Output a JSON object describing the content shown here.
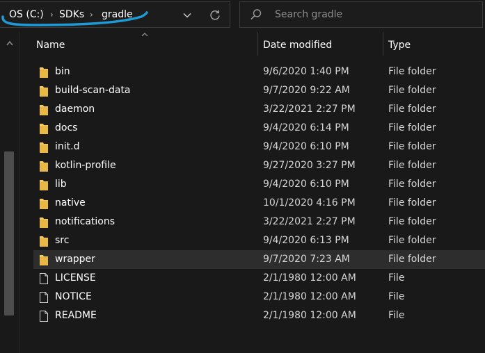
{
  "address_bar": {
    "breadcrumbs": [
      "OS (C:)",
      "SDKs",
      "gradle"
    ],
    "separator": "›"
  },
  "search": {
    "placeholder": "Search gradle",
    "value": ""
  },
  "columns": {
    "name": "Name",
    "date_modified": "Date modified",
    "type": "Type"
  },
  "files": [
    {
      "name": "bin",
      "date": "9/6/2020 1:40 PM",
      "type": "File folder",
      "icon": "folder-icon"
    },
    {
      "name": "build-scan-data",
      "date": "9/7/2020 9:22 AM",
      "type": "File folder",
      "icon": "folder-icon"
    },
    {
      "name": "daemon",
      "date": "3/22/2021 2:27 PM",
      "type": "File folder",
      "icon": "folder-icon"
    },
    {
      "name": "docs",
      "date": "9/4/2020 6:14 PM",
      "type": "File folder",
      "icon": "folder-icon"
    },
    {
      "name": "init.d",
      "date": "9/4/2020 6:10 PM",
      "type": "File folder",
      "icon": "folder-icon"
    },
    {
      "name": "kotlin-profile",
      "date": "9/27/2020 3:27 PM",
      "type": "File folder",
      "icon": "folder-icon"
    },
    {
      "name": "lib",
      "date": "9/4/2020 6:10 PM",
      "type": "File folder",
      "icon": "folder-icon"
    },
    {
      "name": "native",
      "date": "10/1/2020 4:16 PM",
      "type": "File folder",
      "icon": "folder-icon"
    },
    {
      "name": "notifications",
      "date": "3/22/2021 2:27 PM",
      "type": "File folder",
      "icon": "folder-icon"
    },
    {
      "name": "src",
      "date": "9/4/2020 6:13 PM",
      "type": "File folder",
      "icon": "folder-icon"
    },
    {
      "name": "wrapper",
      "date": "9/7/2020 7:23 AM",
      "type": "File folder",
      "icon": "folder-icon",
      "selected": true
    },
    {
      "name": "LICENSE",
      "date": "2/1/1980 12:00 AM",
      "type": "File",
      "icon": "file-icon"
    },
    {
      "name": "NOTICE",
      "date": "2/1/1980 12:00 AM",
      "type": "File",
      "icon": "file-icon"
    },
    {
      "name": "README",
      "date": "2/1/1980 12:00 AM",
      "type": "File",
      "icon": "file-icon"
    }
  ],
  "colors": {
    "background": "#191919",
    "folder": "#f3c95a",
    "annotation_scribble": "#1e9ad6",
    "selected_row": "#2d2d2d"
  }
}
